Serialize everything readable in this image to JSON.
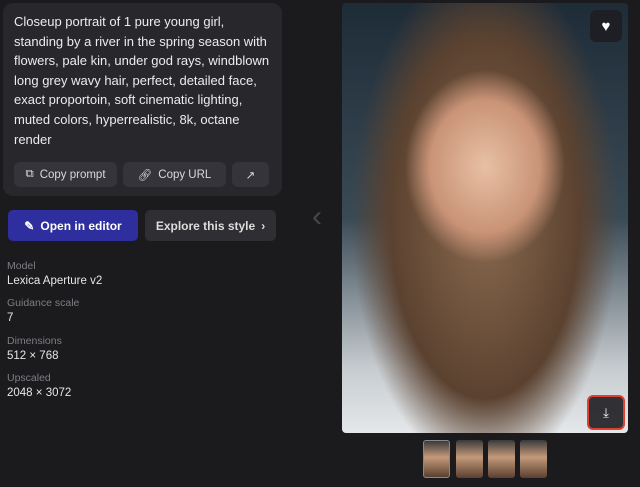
{
  "prompt": "Closeup portrait of 1 pure young girl, standing by a river in the spring season with flowers, pale kin, under god rays, windblown long grey wavy hair, perfect, detailed face, exact proportoin, soft cinematic lighting, muted colors, hyperrealistic, 8k, octane render",
  "buttons": {
    "copy_prompt": "Copy prompt",
    "copy_url": "Copy URL",
    "open_editor": "Open in editor",
    "explore": "Explore this style"
  },
  "meta": [
    {
      "label": "Model",
      "value": "Lexica Aperture v2"
    },
    {
      "label": "Guidance scale",
      "value": "7"
    },
    {
      "label": "Dimensions",
      "value": "512 × 768"
    },
    {
      "label": "Upscaled",
      "value": "2048 × 3072"
    }
  ],
  "colors": {
    "accent": "#2e2e9e",
    "highlight": "#e0402f"
  }
}
